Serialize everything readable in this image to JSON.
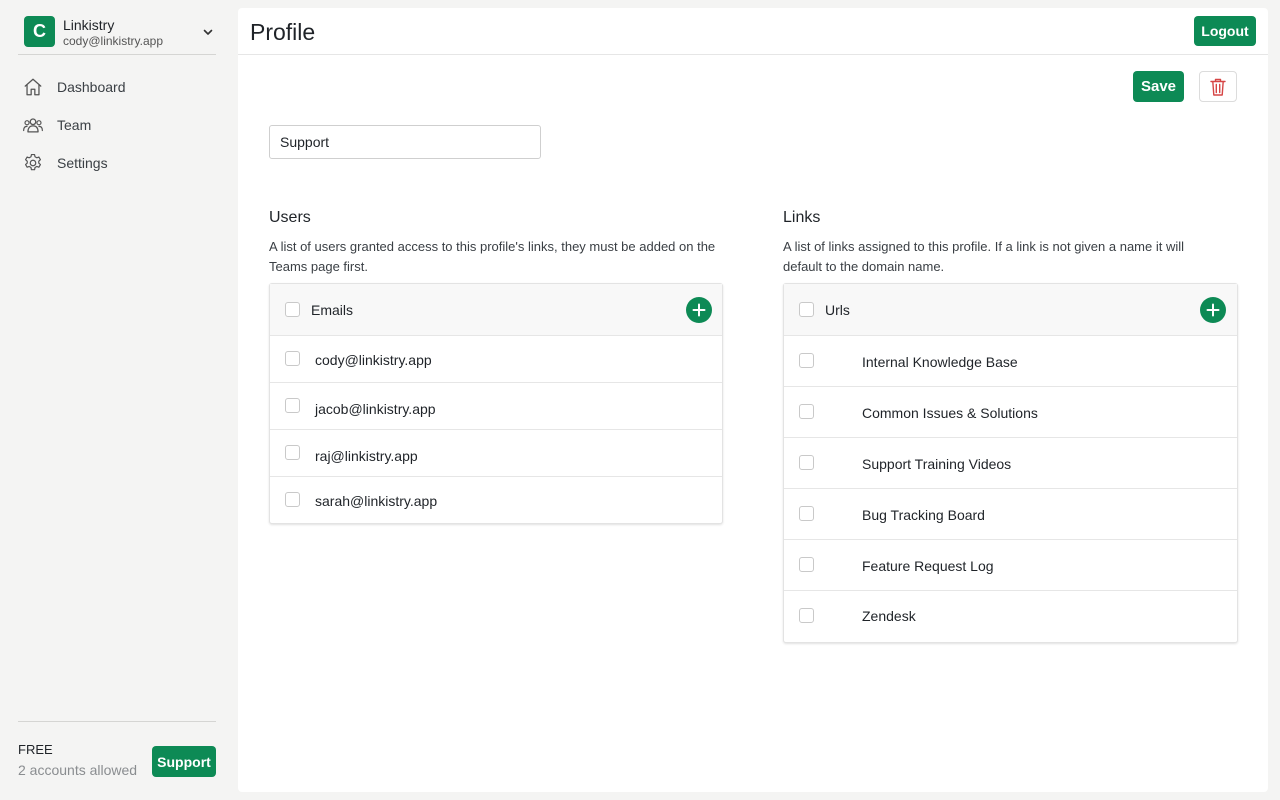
{
  "account": {
    "initial": "C",
    "name": "Linkistry",
    "email": "cody@linkistry.app"
  },
  "nav": {
    "items": [
      {
        "label": "Dashboard",
        "icon": "home-icon"
      },
      {
        "label": "Team",
        "icon": "team-icon"
      },
      {
        "label": "Settings",
        "icon": "gear-icon"
      }
    ]
  },
  "plan": {
    "name": "FREE",
    "description": "2 accounts allowed",
    "support_label": "Support"
  },
  "header": {
    "title": "Profile",
    "logout_label": "Logout"
  },
  "toolbar": {
    "save_label": "Save",
    "delete_icon": "trash-icon"
  },
  "profile": {
    "name_value": "Support"
  },
  "users": {
    "title": "Users",
    "description": "A list of users granted access to this profile's links, they must be added on the Teams page first.",
    "column_header": "Emails",
    "rows": [
      "cody@linkistry.app",
      "jacob@linkistry.app",
      "raj@linkistry.app",
      "sarah@linkistry.app"
    ]
  },
  "links": {
    "title": "Links",
    "description": "A list of links assigned to this profile. If a link is not given a name it will default to the domain name.",
    "column_header": "Urls",
    "rows": [
      "Internal Knowledge Base",
      "Common Issues & Solutions",
      "Support Training Videos",
      "Bug Tracking Board",
      "Feature Request Log",
      "Zendesk"
    ]
  },
  "colors": {
    "accent": "#0d8a55",
    "danger": "#d64545",
    "sidebar_bg": "#f4f4f3"
  }
}
